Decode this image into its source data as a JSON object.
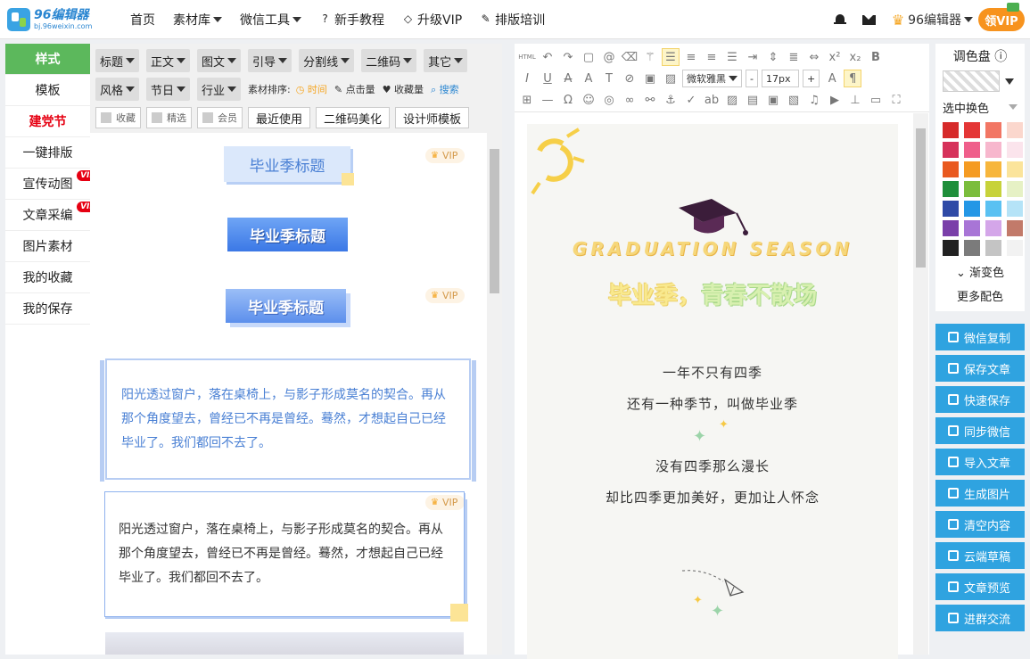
{
  "logo": {
    "name": "96编辑器",
    "url": "bj.96weixin.com"
  },
  "nav": [
    {
      "label": "首页",
      "caret": false,
      "icon": ""
    },
    {
      "label": "素材库",
      "caret": true,
      "icon": ""
    },
    {
      "label": "微信工具",
      "caret": true,
      "icon": ""
    },
    {
      "label": "新手教程",
      "caret": false,
      "icon": "?"
    },
    {
      "label": "升级VIP",
      "caret": false,
      "icon": "◇"
    },
    {
      "label": "排版培训",
      "caret": false,
      "icon": "✎"
    }
  ],
  "user": {
    "name": "96编辑器",
    "vip_button": "领VIP"
  },
  "leftnav": [
    {
      "label": "样式",
      "state": "active"
    },
    {
      "label": "模板",
      "state": ""
    },
    {
      "label": "建党节",
      "state": "red"
    },
    {
      "label": "一键排版",
      "state": ""
    },
    {
      "label": "宣传动图",
      "state": "",
      "badge": "VIP"
    },
    {
      "label": "文章采编",
      "state": "",
      "badge": "VIP"
    },
    {
      "label": "图片素材",
      "state": ""
    },
    {
      "label": "我的收藏",
      "state": ""
    },
    {
      "label": "我的保存",
      "state": ""
    }
  ],
  "filters": {
    "row1": [
      "标题",
      "正文",
      "图文",
      "引导",
      "分割线",
      "二维码",
      "其它"
    ],
    "row2": [
      "风格",
      "节日",
      "行业"
    ],
    "sort_label": "素材排序:",
    "sort_options": [
      "时间",
      "点击量",
      "收藏量"
    ],
    "search": "搜索",
    "checks": [
      "收藏",
      "精选",
      "会员"
    ],
    "buttons": [
      "最近使用",
      "二维码美化",
      "设计师模板"
    ]
  },
  "materials": {
    "vip_label": "VIP",
    "title1": "毕业季标题",
    "title2": "毕业季标题",
    "title3": "毕业季标题",
    "para1": "阳光透过窗户，落在桌椅上，与影子形成莫名的契合。再从那个角度望去，曾经已不再是曾经。蓦然，才想起自己已经毕业了。我们都回不去了。",
    "para2": "阳光透过窗户，落在桌椅上，与影子形成莫名的契合。再从那个角度望去，曾经已不再是曾经。蓦然，才想起自己已经毕业了。我们都回不去了。"
  },
  "toolbar": {
    "html": "HTML",
    "font": "微软雅黑",
    "minus": "-",
    "size": "17px",
    "plus": "+"
  },
  "doc": {
    "eng_title": "GRADUATION SEASON",
    "headline_a": "毕业季，",
    "headline_b": "青春不散场",
    "lines": [
      "一年不只有四季",
      "还有一种季节，叫做毕业季",
      "没有四季那么漫长",
      "却比四季更加美好，更加让人怀念"
    ]
  },
  "palette": {
    "title": "调色盘",
    "replace_label": "选中换色",
    "gradient_link": "渐变色",
    "more_link": "更多配色",
    "colors": [
      "#d62a2a",
      "#e43636",
      "#f27664",
      "#fbd7cd",
      "#d6325a",
      "#ef5f8b",
      "#f7b7cd",
      "#fbe4ec",
      "#e9591f",
      "#f59b22",
      "#f7b63c",
      "#fbe49b",
      "#1f8f3a",
      "#7bbd3c",
      "#c7d23a",
      "#e6f1c5",
      "#2f4aa6",
      "#2497e6",
      "#5ac1f2",
      "#b5e3f7",
      "#7a3fa9",
      "#a875d6",
      "#d4a6e9",
      "#c27a6a",
      "#222222",
      "#7b7b7b",
      "#c4c4c4",
      "#f2f2f2"
    ]
  },
  "actions": [
    "微信复制",
    "保存文章",
    "快速保存",
    "同步微信",
    "导入文章",
    "生成图片",
    "清空内容",
    "云端草稿",
    "文章预览",
    "进群交流"
  ]
}
